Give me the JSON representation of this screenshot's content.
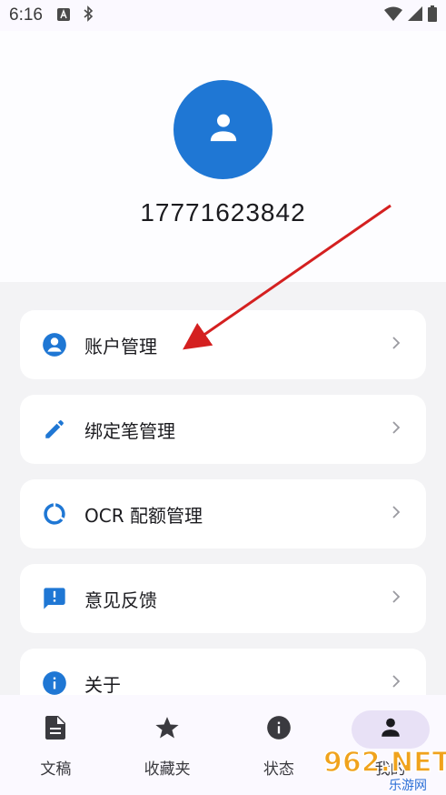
{
  "status_bar": {
    "time": "6:16",
    "left_icons": [
      "font-a-icon",
      "bluetooth-icon"
    ],
    "right_icons": [
      "wifi-icon",
      "signal-icon",
      "battery-icon"
    ]
  },
  "profile": {
    "avatar_icon": "person-icon",
    "phone": "17771623842"
  },
  "menu": [
    {
      "label": "账户管理",
      "icon": "account-circle-icon"
    },
    {
      "label": "绑定笔管理",
      "icon": "pen-icon"
    },
    {
      "label": "OCR 配额管理",
      "icon": "quota-ring-icon"
    },
    {
      "label": "意见反馈",
      "icon": "feedback-icon"
    },
    {
      "label": "关于",
      "icon": "info-icon"
    }
  ],
  "bottom_nav": [
    {
      "label": "文稿",
      "icon": "document-icon",
      "active": false
    },
    {
      "label": "收藏夹",
      "icon": "star-icon",
      "active": false
    },
    {
      "label": "状态",
      "icon": "info-icon",
      "active": false
    },
    {
      "label": "我的",
      "icon": "person-icon",
      "active": true
    }
  ],
  "watermark": {
    "text": "962.NET",
    "subtext": "乐游网"
  },
  "colors": {
    "accent": "#1f77d4",
    "card": "#ffffff",
    "background": "#f3f3f5",
    "nav_active_pill": "#e8e1f6",
    "annotation_arrow": "#d42020"
  }
}
